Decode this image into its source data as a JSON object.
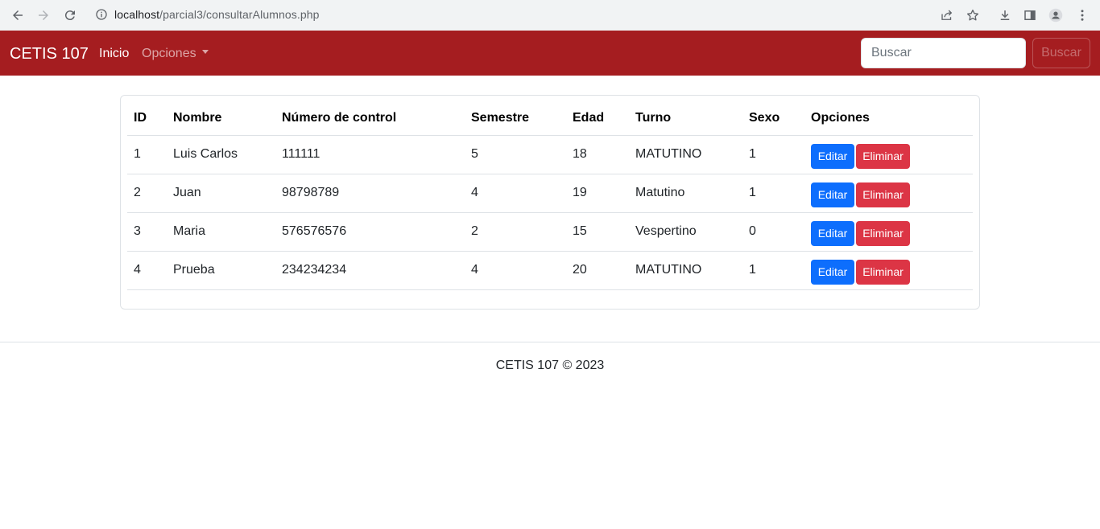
{
  "browser": {
    "url_host": "localhost",
    "url_path": "/parcial3/consultarAlumnos.php"
  },
  "navbar": {
    "brand": "CETIS 107",
    "links": [
      {
        "label": "Inicio"
      },
      {
        "label": "Opciones"
      }
    ],
    "search_placeholder": "Buscar",
    "search_button": "Buscar",
    "bg_color": "#a51d20"
  },
  "table": {
    "headers": [
      "ID",
      "Nombre",
      "Número de control",
      "Semestre",
      "Edad",
      "Turno",
      "Sexo",
      "Opciones"
    ],
    "rows": [
      {
        "id": "1",
        "nombre": "Luis Carlos",
        "control": "111111",
        "semestre": "5",
        "edad": "18",
        "turno": "MATUTINO",
        "sexo": "1"
      },
      {
        "id": "2",
        "nombre": "Juan",
        "control": "98798789",
        "semestre": "4",
        "edad": "19",
        "turno": "Matutino",
        "sexo": "1"
      },
      {
        "id": "3",
        "nombre": "Maria",
        "control": "576576576",
        "semestre": "2",
        "edad": "15",
        "turno": "Vespertino",
        "sexo": "0"
      },
      {
        "id": "4",
        "nombre": "Prueba",
        "control": "234234234",
        "semestre": "4",
        "edad": "20",
        "turno": "MATUTINO",
        "sexo": "1"
      }
    ],
    "edit_label": "Editar",
    "delete_label": "Eliminar",
    "edit_color": "#0d6efd",
    "delete_color": "#dc3545"
  },
  "footer": {
    "text": "CETIS 107 © 2023"
  }
}
